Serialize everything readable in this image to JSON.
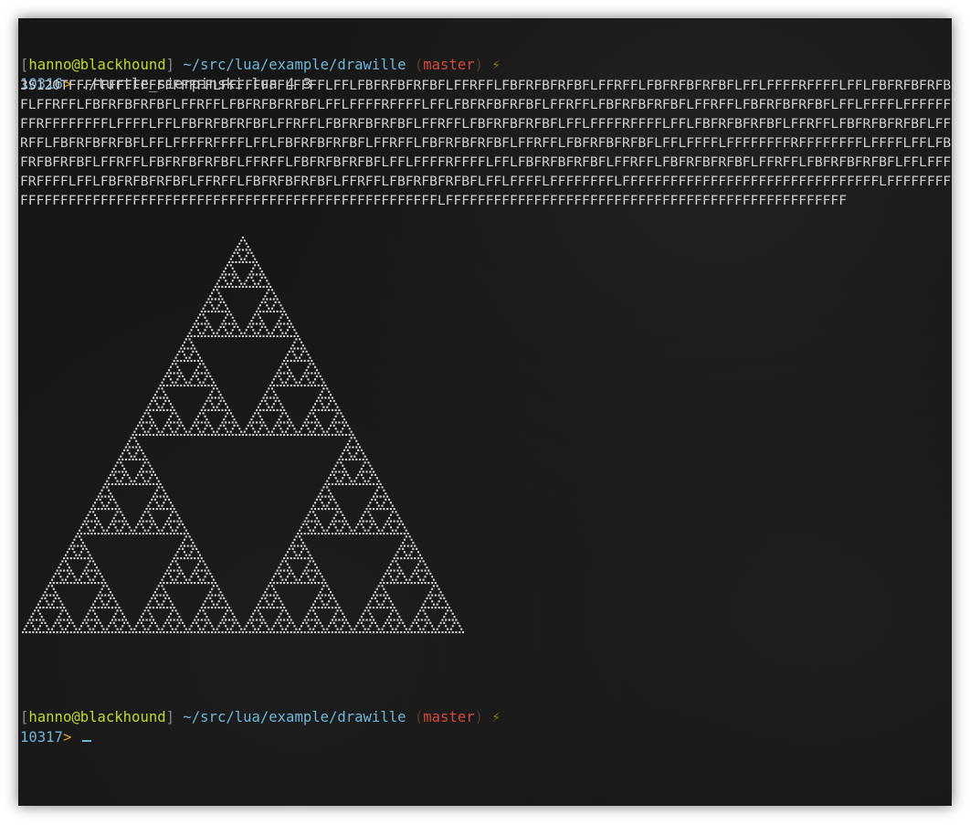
{
  "prompt1": {
    "bracket_open": "[",
    "user_host": "hanno@blackhound",
    "bracket_close": "]",
    "path": "~/src/lua/example/drawille",
    "paren_open": "(",
    "branch": "master",
    "paren_close": ")",
    "status_icon": "lightning-bolt-icon",
    "bolt": "⚡",
    "history_number": "10316",
    "arrow": ">",
    "command": "./turtle_sierpinski.lua 4 3"
  },
  "output": {
    "lsystem_text": "3S120TFFFFFFFFFFFFFFFFFFLFFFFFFFFLFFFFLFFLFBFRFBFRFBFLFFRFFLFBFRFBFRFBFLFFRFFLFBFRFBFRFBFLFFLFFFFRFFFFLFFLFBFRFBFRFBFLFFRFFLFBFRFBFRFBFLFFRFFLFBFRFBFRFBFLFFLFFFFRFFFFLFFLFBFRFBFRFBFLFFRFFLFBFRFBFRFBFLFFRFFLFBFRFBFRFBFLFFLFFFFLFFFFFFFFRFFFFFFFFLFFFFLFFLFBFRFBFRFBFLFFRFFLFBFRFBFRFBFLFFRFFLFBFRFBFRFBFLFFLFFFFRFFFFLFFLFBFRFBFRFBFLFFRFFLFBFRFBFRFBFLFFRFFLFBFRFBFRFBFLFFLFFFFRFFFFLFFLFBFRFBFRFBFLFFRFFLFBFRFBFRFBFLFFRFFLFBFRFBFRFBFLFFLFFFFLFFFFFFFFRFFFFFFFFLFFFFLFFLFBFRFBFRFBFLFFRFFLFBFRFBFRFBFLFFRFFLFBFRFBFRFBFLFFLFFFFRFFFFLFFLFBFRFBFRFBFLFFRFFLFBFRFBFRFBFLFFRFFLFBFRFBFRFBFLFFLFFFFRFFFFLFFLFBFRFBFRFBFLFFRFFLFBFRFBFRFBFLFFRFFLFBFRFBFRFBFLFFLFFFFLFFFFFFFFLFFFFFFFFFFFFFFFFFFFFFFFFFFFFFFFFLFFFFFFFFFFFFFFFFFFFFFFFFFFFFFFFFFFFFFFFFFFFFFFFFFFFFFFFFFFFFLFFFFFFFFFFFFFFFFFFFFFFFFFFFFFFFFFFFFFFFFFFFFFFFFFF"
  },
  "drawing": {
    "name": "sierpinski-triangle-braille-render",
    "dot_color": "#d4d4d4",
    "recursion_depth": 5
  },
  "prompt2": {
    "bracket_open": "[",
    "user_host": "hanno@blackhound",
    "bracket_close": "]",
    "path": "~/src/lua/example/drawille",
    "paren_open": "(",
    "branch": "master",
    "paren_close": ")",
    "status_icon": "lightning-bolt-icon",
    "bolt": "⚡",
    "history_number": "10317",
    "arrow": ">",
    "cursor_icon": "text-cursor-icon"
  },
  "colors": {
    "background": "#161616",
    "user_host": "#c3d82c",
    "path": "#6fb6d8",
    "branch": "#d6483a",
    "arrow": "#e0a020",
    "text": "#c8c8c8"
  }
}
